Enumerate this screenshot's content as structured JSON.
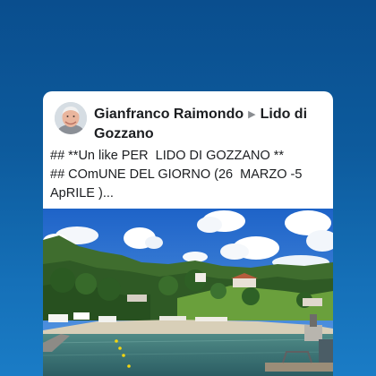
{
  "post": {
    "author": "Gianfranco Raimondo",
    "separator_icon": "right-triangle-icon",
    "target": "Lido di Gozzano",
    "text": "## **Un like PER  LIDO DI GOZZANO **\n## COmUNE DEL GIORNO (26  MARZO -5 ApRILE )..."
  },
  "colors": {
    "background_top": "#0a4e8e",
    "background_bottom": "#1a7cc6",
    "card": "#ffffff",
    "text": "#1c1e21"
  },
  "photo": {
    "subject": "lake-beach-resort-photo"
  }
}
